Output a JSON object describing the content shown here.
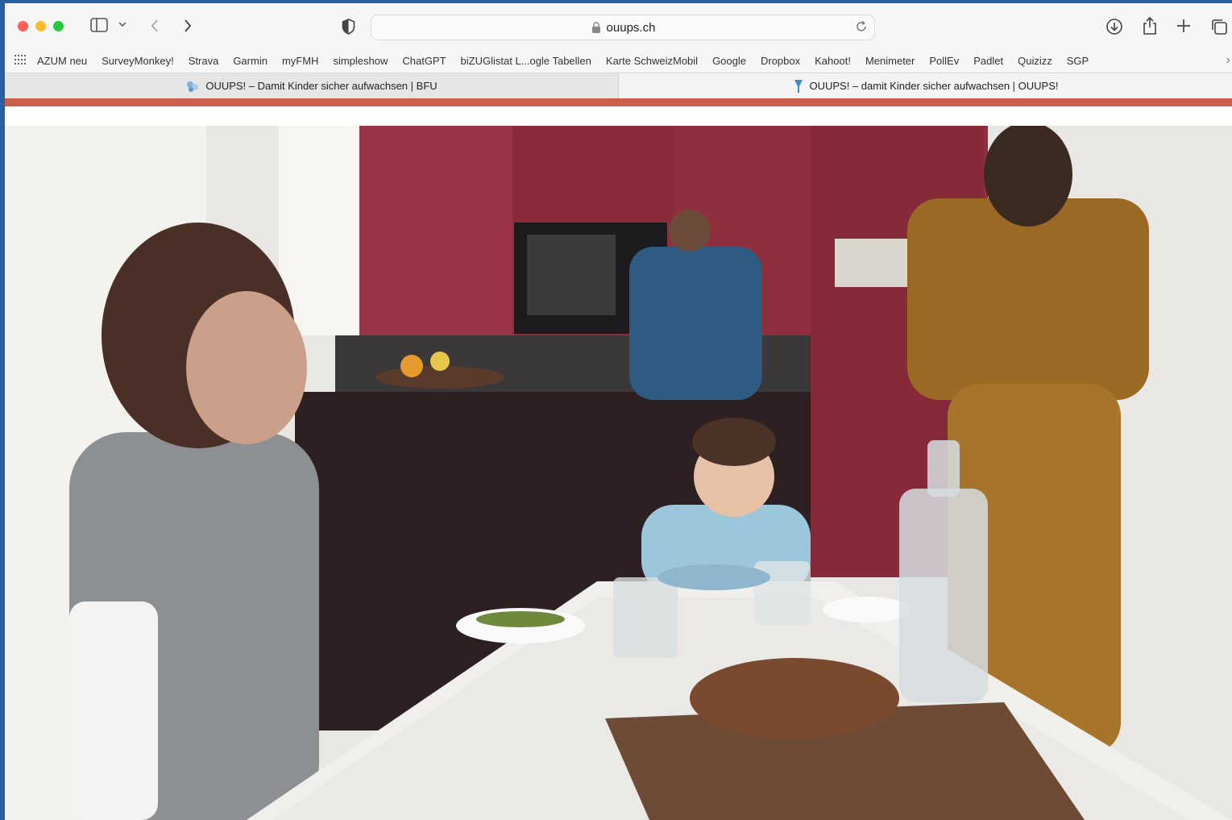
{
  "browser": {
    "url": "ouups.ch"
  },
  "bookmarks": [
    "AZUM neu",
    "SurveyMonkey!",
    "Strava",
    "Garmin",
    "myFMH",
    "simpleshow",
    "ChatGPT",
    "biZUGlistat L...ogle Tabellen",
    "Karte SchweizMobil",
    "Google",
    "Dropbox",
    "Kahoot!",
    "Menimeter",
    "PollEv",
    "Padlet",
    "Quizizz",
    "SGP"
  ],
  "tabs": [
    {
      "title": "OUUPS! – Damit Kinder sicher aufwachsen | BFU",
      "active": false,
      "icon": "bfu-favicon"
    },
    {
      "title": "OUUPS! – damit Kinder sicher aufwachsen | OUUPS!",
      "active": true,
      "icon": "ouups-favicon"
    }
  ],
  "colors": {
    "accent": "#c95f4c",
    "desktop": "#2a5fa0"
  },
  "hero": {
    "image": "family-kitchen-photo"
  }
}
